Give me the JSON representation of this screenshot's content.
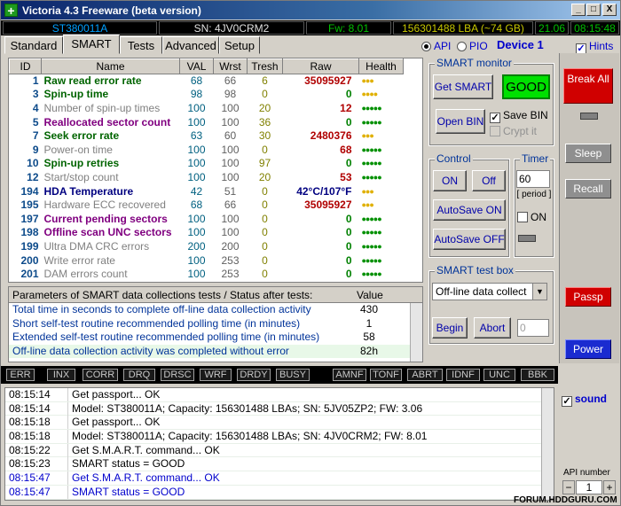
{
  "window": {
    "title": "Victoria 4.3 Freeware (beta version)",
    "min": "_",
    "max": "□",
    "close": "X"
  },
  "status": {
    "model": "ST380011A",
    "sn": "SN: 4JV0CRM2",
    "fw": "Fw: 8.01",
    "lba": "156301488 LBA (~74 GB)",
    "date": "21.06",
    "time": "08:15:48"
  },
  "tabs": [
    "Standard",
    "SMART",
    "Tests",
    "Advanced",
    "Setup"
  ],
  "port": {
    "api": "API",
    "pio": "PIO",
    "device": "Device 1",
    "hints": "Hints"
  },
  "smart_table": {
    "headers": [
      "ID",
      "Name",
      "VAL",
      "Wrst",
      "Tresh",
      "Raw",
      "Health"
    ],
    "rows": [
      {
        "id": "1",
        "name": "Raw read error rate",
        "val": "68",
        "wrst": "66",
        "tresh": "6",
        "raw": "35095927",
        "health": "●●●",
        "hc": "#e0b000",
        "nc": "#006400",
        "bold": true
      },
      {
        "id": "3",
        "name": "Spin-up time",
        "val": "98",
        "wrst": "98",
        "tresh": "0",
        "raw": "0",
        "health": "●●●●",
        "hc": "#e0b000",
        "nc": "#006400",
        "bold": true
      },
      {
        "id": "4",
        "name": "Number of spin-up times",
        "val": "100",
        "wrst": "100",
        "tresh": "20",
        "raw": "12",
        "health": "●●●●●",
        "hc": "#009000",
        "nc": "#808080",
        "bold": false
      },
      {
        "id": "5",
        "name": "Reallocated sector count",
        "val": "100",
        "wrst": "100",
        "tresh": "36",
        "raw": "0",
        "health": "●●●●●",
        "hc": "#009000",
        "nc": "#800080",
        "bold": true
      },
      {
        "id": "7",
        "name": "Seek error rate",
        "val": "63",
        "wrst": "60",
        "tresh": "30",
        "raw": "2480376",
        "health": "●●●",
        "hc": "#e0b000",
        "nc": "#006400",
        "bold": true
      },
      {
        "id": "9",
        "name": "Power-on time",
        "val": "100",
        "wrst": "100",
        "tresh": "0",
        "raw": "68",
        "health": "●●●●●",
        "hc": "#009000",
        "nc": "#808080",
        "bold": false
      },
      {
        "id": "10",
        "name": "Spin-up retries",
        "val": "100",
        "wrst": "100",
        "tresh": "97",
        "raw": "0",
        "health": "●●●●●",
        "hc": "#009000",
        "nc": "#006400",
        "bold": true
      },
      {
        "id": "12",
        "name": "Start/stop count",
        "val": "100",
        "wrst": "100",
        "tresh": "20",
        "raw": "53",
        "health": "●●●●●",
        "hc": "#009000",
        "nc": "#808080",
        "bold": false
      },
      {
        "id": "194",
        "name": "HDA Temperature",
        "val": "42",
        "wrst": "51",
        "tresh": "0",
        "raw": "42°C/107°F",
        "health": "●●●",
        "hc": "#e0b000",
        "nc": "#000080",
        "bold": true
      },
      {
        "id": "195",
        "name": "Hardware ECC recovered",
        "val": "68",
        "wrst": "66",
        "tresh": "0",
        "raw": "35095927",
        "health": "●●●",
        "hc": "#e0b000",
        "nc": "#808080",
        "bold": false
      },
      {
        "id": "197",
        "name": "Current pending sectors",
        "val": "100",
        "wrst": "100",
        "tresh": "0",
        "raw": "0",
        "health": "●●●●●",
        "hc": "#009000",
        "nc": "#800080",
        "bold": true
      },
      {
        "id": "198",
        "name": "Offline scan UNC sectors",
        "val": "100",
        "wrst": "100",
        "tresh": "0",
        "raw": "0",
        "health": "●●●●●",
        "hc": "#009000",
        "nc": "#800080",
        "bold": true
      },
      {
        "id": "199",
        "name": "Ultra DMA CRC errors",
        "val": "200",
        "wrst": "200",
        "tresh": "0",
        "raw": "0",
        "health": "●●●●●",
        "hc": "#009000",
        "nc": "#808080",
        "bold": false
      },
      {
        "id": "200",
        "name": "Write error rate",
        "val": "100",
        "wrst": "253",
        "tresh": "0",
        "raw": "0",
        "health": "●●●●●",
        "hc": "#009000",
        "nc": "#808080",
        "bold": false
      },
      {
        "id": "201",
        "name": "DAM errors count",
        "val": "100",
        "wrst": "253",
        "tresh": "0",
        "raw": "0",
        "health": "●●●●●",
        "hc": "#009000",
        "nc": "#808080",
        "bold": false
      }
    ]
  },
  "params": {
    "header": "Parameters of SMART data collections tests / Status after tests:",
    "value_header": "Value",
    "rows": [
      {
        "label": "Total time in seconds to complete off-line data collection activity",
        "value": "430"
      },
      {
        "label": "Short self-test routine recommended polling time (in minutes)",
        "value": "1"
      },
      {
        "label": "Extended self-test routine recommended polling time (in minutes)",
        "value": "58"
      },
      {
        "label": "Off-line data collection activity was completed without error",
        "value": "82h"
      }
    ]
  },
  "smart_monitor": {
    "label": "SMART monitor",
    "get_smart": "Get SMART",
    "status": "GOOD",
    "open_bin": "Open BIN",
    "save_bin": "Save BIN",
    "crypt": "Crypt it"
  },
  "control": {
    "label": "Control",
    "on": "ON",
    "off": "Off",
    "autosave_on": "AutoSave ON",
    "autosave_off": "AutoSave OFF"
  },
  "timer": {
    "label": "Timer",
    "value": "60",
    "period": "[ period ]",
    "on": "ON"
  },
  "testbox": {
    "label": "SMART test box",
    "selected": "Off-line data collect",
    "begin": "Begin",
    "abort": "Abort",
    "counter": "0"
  },
  "side": {
    "break": "Break All",
    "sleep": "Sleep",
    "recall": "Recall",
    "passp": "Passp",
    "power": "Power",
    "sound": "sound",
    "api_label": "API number",
    "api_minus": "−",
    "api_value": "1",
    "api_plus": "+"
  },
  "registers_left": [
    "ERR",
    "INX",
    "CORR",
    "DRQ",
    "DRSC",
    "WRF",
    "DRDY",
    "BUSY"
  ],
  "registers_right": [
    "AMNF",
    "TONF",
    "ABRT",
    "IDNF",
    "UNC",
    "BBK"
  ],
  "log": [
    {
      "t": "08:15:14",
      "m": "Get passport... OK",
      "c": "#000000"
    },
    {
      "t": "08:15:14",
      "m": "Model: ST380011A; Capacity: 156301488 LBAs; SN: 5JV05ZP2; FW: 3.06",
      "c": "#000000"
    },
    {
      "t": "08:15:18",
      "m": "Get passport... OK",
      "c": "#000000"
    },
    {
      "t": "08:15:18",
      "m": "Model: ST380011A; Capacity: 156301488 LBAs; SN: 4JV0CRM2; FW: 8.01",
      "c": "#000000"
    },
    {
      "t": "08:15:22",
      "m": "Get S.M.A.R.T. command... OK",
      "c": "#000000"
    },
    {
      "t": "08:15:23",
      "m": "SMART status = GOOD",
      "c": "#000000"
    },
    {
      "t": "08:15:47",
      "m": "Get S.M.A.R.T. command... OK",
      "c": "#0000cc"
    },
    {
      "t": "08:15:47",
      "m": "SMART status = GOOD",
      "c": "#0000cc"
    }
  ],
  "watermark": "FORUM.HDDGURU.COM"
}
